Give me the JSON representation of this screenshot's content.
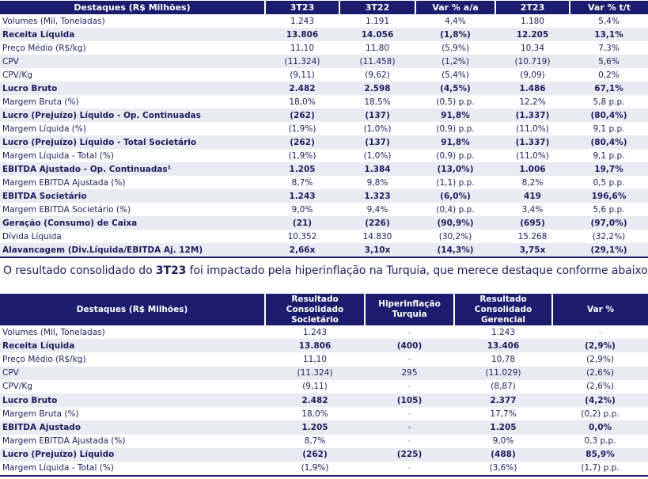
{
  "table1": {
    "headers": [
      "Destaques (R$ Milhões)",
      "3T23",
      "3T22",
      "Var % a/a",
      "2T23",
      "Var % t/t"
    ],
    "rows": [
      {
        "bold": false,
        "cells": [
          "Volumes (Mil, Toneladas)",
          "1.243",
          "1.191",
          "4,4%",
          "1.180",
          "5,4%"
        ]
      },
      {
        "bold": true,
        "cells": [
          "Receita Líquida",
          "13.806",
          "14.056",
          "(1,8%)",
          "12.205",
          "13,1%"
        ]
      },
      {
        "bold": false,
        "cells": [
          "Preço Médio (R$/kg)",
          "11,10",
          "11,80",
          "(5,9%)",
          "10,34",
          "7,3%"
        ]
      },
      {
        "bold": false,
        "cells": [
          "CPV",
          "(11.324)",
          "(11.458)",
          "(1,2%)",
          "(10.719)",
          "5,6%"
        ]
      },
      {
        "bold": false,
        "cells": [
          "CPV/Kg",
          "(9,11)",
          "(9,62)",
          "(5,4%)",
          "(9,09)",
          "0,2%"
        ]
      },
      {
        "bold": true,
        "cells": [
          "Lucro Bruto",
          "2.482",
          "2.598",
          "(4,5%)",
          "1.486",
          "67,1%"
        ]
      },
      {
        "bold": false,
        "cells": [
          "Margem Bruta (%)",
          "18,0%",
          "18,5%",
          "(0,5) p.p.",
          "12,2%",
          "5,8 p.p."
        ]
      },
      {
        "bold": true,
        "cells": [
          "Lucro (Prejuízo) Líquido - Op. Continuadas",
          "(262)",
          "(137)",
          "91,8%",
          "(1.337)",
          "(80,4%)"
        ]
      },
      {
        "bold": false,
        "cells": [
          "Margem Líquida (%)",
          "(1,9%)",
          "(1,0%)",
          "(0,9) p.p.",
          "(11,0%)",
          "9,1 p.p."
        ]
      },
      {
        "bold": true,
        "cells": [
          "Lucro (Prejuízo) Líquido - Total Societário",
          "(262)",
          "(137)",
          "91,8%",
          "(1.337)",
          "(80,4%)"
        ]
      },
      {
        "bold": false,
        "cells": [
          "Margem Líquida - Total (%)",
          "(1,9%)",
          "(1,0%)",
          "(0,9) p.p.",
          "(11,0%)",
          "9,1 p.p."
        ]
      },
      {
        "bold": true,
        "cells": [
          "EBITDA Ajustado - Op. Continuadas¹",
          "1.205",
          "1.384",
          "(13,0%)",
          "1.006",
          "19,7%"
        ]
      },
      {
        "bold": false,
        "cells": [
          "Margem EBITDA Ajustada (%)",
          "8,7%",
          "9,8%",
          "(1,1) p.p.",
          "8,2%",
          "0,5 p.p."
        ]
      },
      {
        "bold": true,
        "cells": [
          "EBITDA Societário",
          "1.243",
          "1.323",
          "(6,0%)",
          "419",
          "196,6%"
        ]
      },
      {
        "bold": false,
        "cells": [
          "Margem EBITDA Societário (%)",
          "9,0%",
          "9,4%",
          "(0,4) p.p.",
          "3,4%",
          "5,6 p.p."
        ]
      },
      {
        "bold": true,
        "cells": [
          "Geração (Consumo) de Caixa",
          "(21)",
          "(226)",
          "(90,9%)",
          "(695)",
          "(97,0%)"
        ]
      },
      {
        "bold": false,
        "cells": [
          "Dívida Líquida",
          "10.352",
          "14.830",
          "(30,2%)",
          "15.268",
          "(32,2%)"
        ]
      },
      {
        "bold": true,
        "cells": [
          "Alavancagem (Div.Líquida/EBITDA Aj. 12M)",
          "2,66x",
          "3,10x",
          "(14,3%)",
          "3,75x",
          "(29,1%)"
        ]
      }
    ]
  },
  "sentence": {
    "before": "O resultado consolidado do ",
    "highlight": "3T23",
    "after": " foi impactado pela hiperinflação na Turquia, que merece destaque conforme abaixo:"
  },
  "table2": {
    "headers": [
      "Destaques (R$ Milhões)",
      "Resultado Consolidado Societário",
      "Hiperinflação Turquia",
      "Resultado Consolidado Gerencial",
      "Var %"
    ],
    "rows": [
      {
        "bold": false,
        "cells": [
          "Volumes (Mil, Toneladas)",
          "1.243",
          "-",
          "1.243",
          "-"
        ]
      },
      {
        "bold": true,
        "cells": [
          "Receita Líquida",
          "13.806",
          "(400)",
          "13.406",
          "(2,9%)"
        ]
      },
      {
        "bold": false,
        "cells": [
          "Preço Médio (R$/kg)",
          "11,10",
          "-",
          "10,78",
          "(2,9%)"
        ]
      },
      {
        "bold": false,
        "cells": [
          "CPV",
          "(11.324)",
          "295",
          "(11.029)",
          "(2,6%)"
        ]
      },
      {
        "bold": false,
        "cells": [
          "CPV/Kg",
          "(9,11)",
          "-",
          "(8,87)",
          "(2,6%)"
        ]
      },
      {
        "bold": true,
        "cells": [
          "Lucro Bruto",
          "2.482",
          "(105)",
          "2.377",
          "(4,2%)"
        ]
      },
      {
        "bold": false,
        "cells": [
          "Margem Bruta (%)",
          "18,0%",
          "-",
          "17,7%",
          "(0,2) p.p."
        ]
      },
      {
        "bold": true,
        "cells": [
          "EBITDA Ajustado",
          "1.205",
          "-",
          "1.205",
          "0,0%"
        ]
      },
      {
        "bold": false,
        "cells": [
          "Margem EBITDA Ajustada (%)",
          "8,7%",
          "-",
          "9,0%",
          "0,3 p.p."
        ]
      },
      {
        "bold": true,
        "cells": [
          "Lucro (Prejuízo) Líquido",
          "(262)",
          "(225)",
          "(488)",
          "85,9%"
        ]
      },
      {
        "bold": false,
        "cells": [
          "Margem Líquida - Total (%)",
          "(1,9%)",
          "-",
          "(3,6%)",
          "(1,7) p.p."
        ]
      }
    ]
  }
}
